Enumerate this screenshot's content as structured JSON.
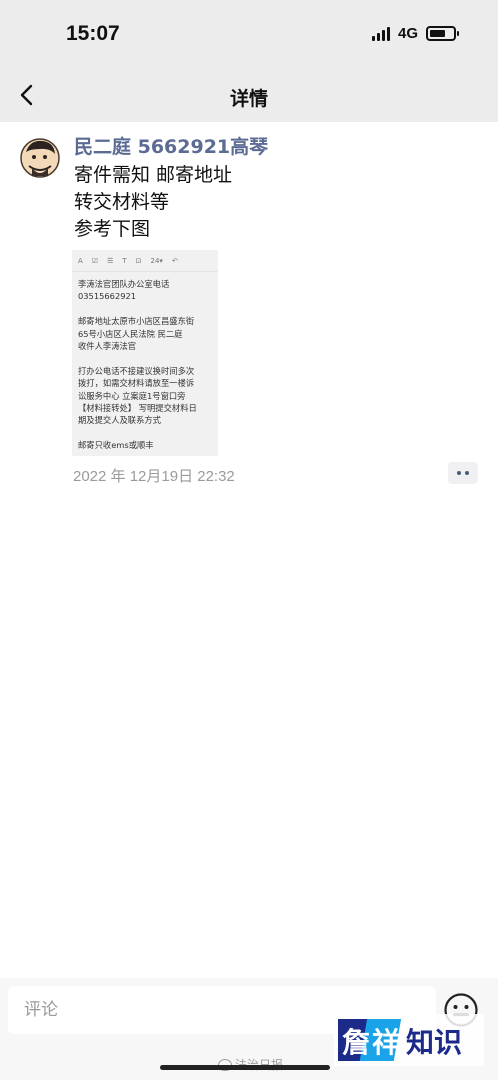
{
  "status_bar": {
    "time": "15:07",
    "network": "4G"
  },
  "nav": {
    "title": "详情"
  },
  "post": {
    "author": "民二庭 5662921高琴",
    "lines": [
      "寄件需知 邮寄地址",
      "转交材料等",
      "参考下图"
    ],
    "image": {
      "toolbar": [
        "A",
        "☑",
        "☰",
        "T",
        "⊡",
        "24▾",
        "↶"
      ],
      "lines": [
        "李涛法官团队办公室电话",
        "03515662921",
        "",
        "邮寄地址太原市小店区昌盛东街",
        "65号小店区人民法院 民二庭",
        "收件人李涛法官",
        "",
        "打办公电话不接建议换时间多次",
        "拨打，如需交材料请放至一楼诉",
        "讼服务中心 立案庭1号窗口旁",
        "【材料接转处】 写明提交材料日",
        "期及提交人及联系方式",
        "",
        "邮寄只收ems或顺丰"
      ]
    },
    "date": "2022 年 12月19日 22:32"
  },
  "comment": {
    "placeholder": "评论"
  },
  "watermark": {
    "source": "法治日报",
    "logo_text": "詹祥知识",
    "logo_color": "#1c2a8a",
    "accent_color": "#1aa3e8"
  },
  "colors": {
    "author": "#5b6b93",
    "date": "#9a9a9a",
    "header_bg": "#ececec"
  }
}
